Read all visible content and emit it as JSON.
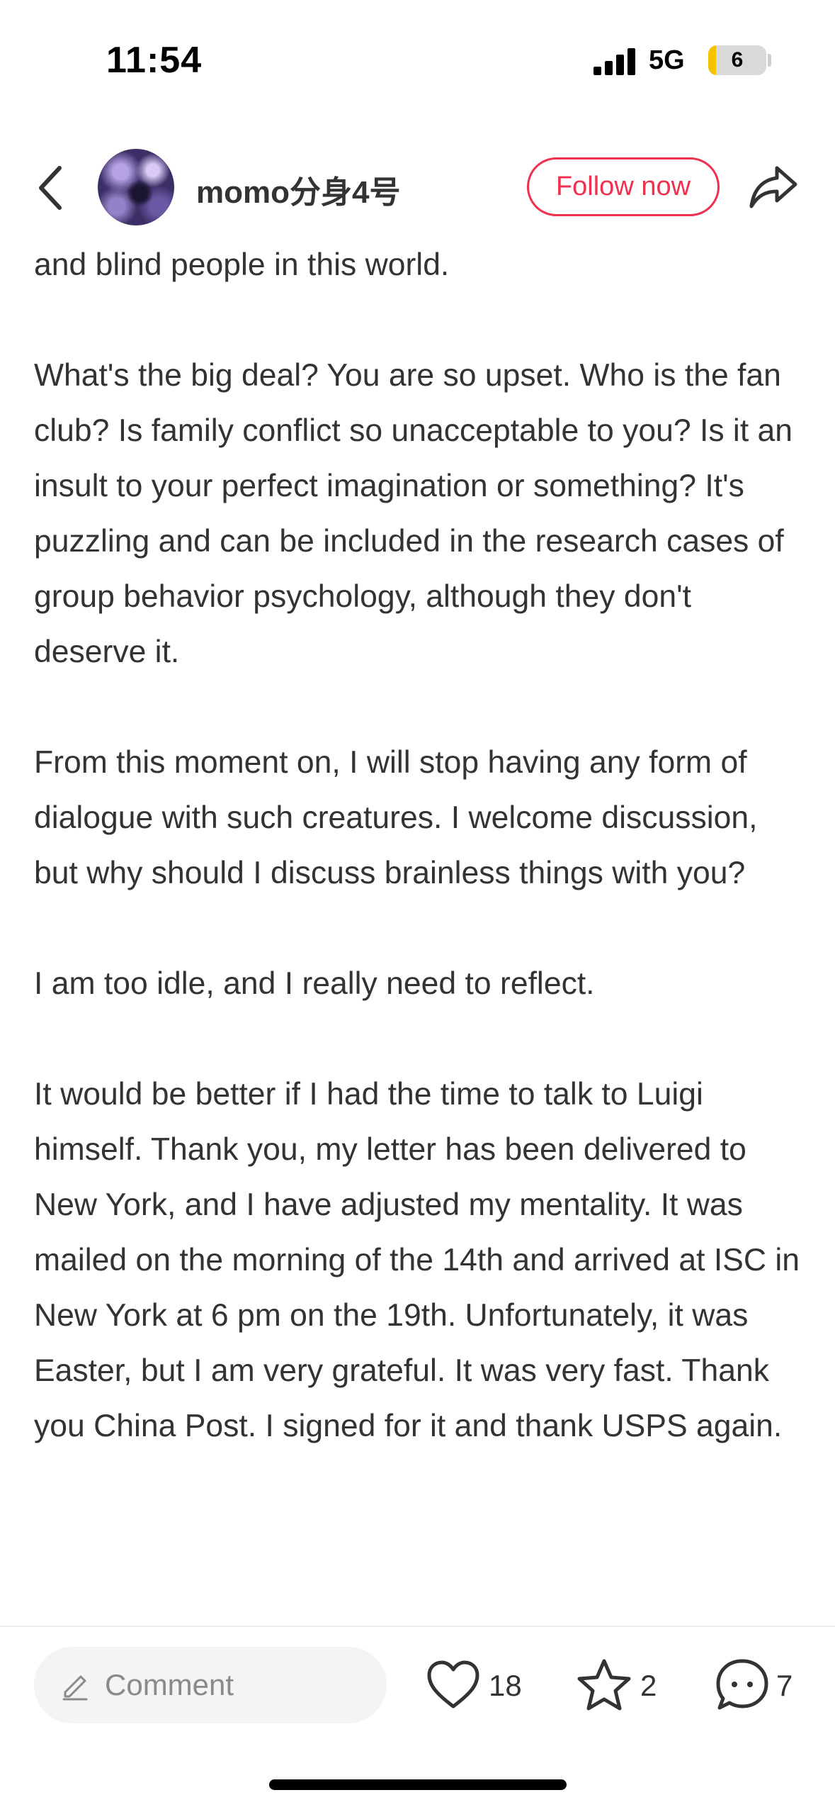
{
  "status_bar": {
    "time": "11:54",
    "network": "5G",
    "battery_level": "6",
    "battery_fraction": 0.06
  },
  "header": {
    "username": "momo分身4号",
    "follow_label": "Follow now"
  },
  "post": {
    "paragraphs": [
      "and blind people in this world.",
      " What's the big deal? You are so upset. Who is the fan club? Is family conflict so unacceptable to you? Is it an insult to your perfect imagination or something? It's puzzling and can be included in the research cases of group behavior psychology, although they don't deserve it.",
      " From this moment on, I will stop having any form of dialogue with such creatures. I welcome discussion, but why should I discuss brainless things with you?",
      " I am too idle, and I really need to reflect.",
      " It would be better if I had the time to talk to Luigi himself. Thank you, my letter has been delivered to New York, and I have adjusted my mentality. It was mailed on the morning of the 14th and arrived at ISC in New York at 6 pm on the 19th. Unfortunately, it was Easter, but I am very grateful. It was very fast. Thank you China Post. I signed for it and thank USPS again."
    ]
  },
  "bottom_bar": {
    "comment_placeholder": "Comment",
    "likes": "18",
    "favorites": "2",
    "comments": "7"
  },
  "colors": {
    "accent": "#f0304f",
    "text": "#333333",
    "battery_low": "#f5c400"
  },
  "icons": {
    "back": "chevron-left-icon",
    "share": "share-arrow-icon",
    "comment_input": "pencil-icon",
    "like": "heart-icon",
    "favorite": "star-icon",
    "comment": "speech-bubble-icon"
  }
}
